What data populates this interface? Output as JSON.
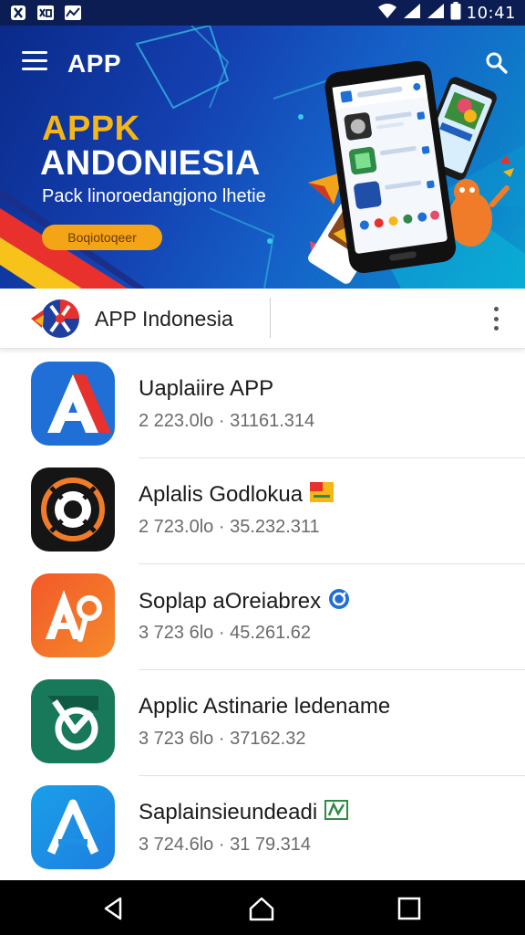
{
  "status_bar": {
    "time": "10:41",
    "left_icons": [
      "x-logo-icon",
      "gallery-icon",
      "chart-icon"
    ],
    "right_icons": [
      "wifi-icon",
      "signal-icon",
      "signal-icon",
      "battery-icon"
    ]
  },
  "banner": {
    "app_title": "APP",
    "headline_line1": "APPK",
    "headline_line2": "ANDONIESIA",
    "subline": "Pack linoroedangjono lhetie",
    "cta_label": "Boqiotoqeer"
  },
  "app_header": {
    "title": "APP Indonesia"
  },
  "apps": [
    {
      "name": "Uaplaiire APP",
      "meta": "2 223.0lo · 31161.314",
      "icon": "red-a-app-icon",
      "badge": ""
    },
    {
      "name": "Aplalis Godlokua",
      "meta": "2 723.0lo · 35.232.311",
      "icon": "camera-lens-app-icon",
      "badge": "flag-badge-icon"
    },
    {
      "name": "Soplap aOreiabrex",
      "meta": "3 723 6lo · 45.261.62",
      "icon": "orange-a-app-icon",
      "badge": "verified-badge-icon"
    },
    {
      "name": "Applic Astinarie ledename",
      "meta": "3 723 6lo · 37162.32",
      "icon": "green-b-app-icon",
      "badge": ""
    },
    {
      "name": "Saplainsieundeadi",
      "meta": "3 724.6lo · 31 79.314",
      "icon": "blue-a-app-icon",
      "badge": "chart-badge-icon"
    }
  ],
  "nav_bar": {
    "buttons": [
      "back-icon",
      "home-icon",
      "recents-icon"
    ]
  },
  "colors": {
    "banner_accent": "#f4b619",
    "status_bar_bg": "#0b1d52",
    "cta_bg": "#f4a417"
  }
}
